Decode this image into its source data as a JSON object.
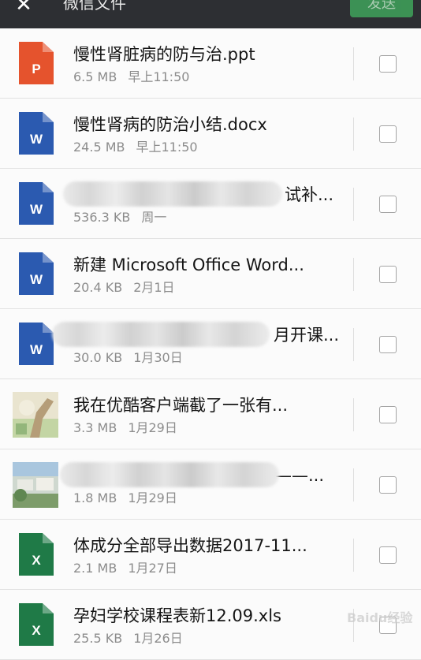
{
  "header": {
    "back_label": "✕",
    "title": "微信文件",
    "send_label": "发送"
  },
  "files": [
    {
      "name": "慢性肾脏病的防与治.ppt",
      "size": "6.5 MB",
      "date": "早上11:50",
      "type": "ppt",
      "icon_label": "P",
      "color": "#e5532d"
    },
    {
      "name": "慢性肾病的防治小结.docx",
      "size": "24.5 MB",
      "date": "早上11:50",
      "type": "word",
      "icon_label": "W",
      "color": "#2b5ab0"
    },
    {
      "name": "试补...",
      "size": "536.3 KB",
      "date": "周一",
      "type": "word",
      "icon_label": "W",
      "color": "#2b5ab0"
    },
    {
      "name": "新建 Microsoft Office Word...",
      "size": "20.4 KB",
      "date": "2月1日",
      "type": "word",
      "icon_label": "W",
      "color": "#2b5ab0"
    },
    {
      "name": "月开课...",
      "size": "30.0 KB",
      "date": "1月30日",
      "type": "word",
      "icon_label": "W",
      "color": "#2b5ab0"
    },
    {
      "name": "我在优酷客户端截了一张有...",
      "size": "3.3 MB",
      "date": "1月29日",
      "type": "image",
      "icon_label": "",
      "color": "#c9c2a0"
    },
    {
      "name": "——...",
      "size": "1.8 MB",
      "date": "1月29日",
      "type": "image",
      "icon_label": "",
      "color": "#9ab88e"
    },
    {
      "name": "体成分全部导出数据2017-11...",
      "size": "2.1 MB",
      "date": "1月27日",
      "type": "excel",
      "icon_label": "X",
      "color": "#1f7a47"
    },
    {
      "name": "孕妇学校课程表新12.09.xls",
      "size": "25.5 KB",
      "date": "1月26日",
      "type": "excel",
      "icon_label": "X",
      "color": "#1f7a47"
    }
  ],
  "watermark": "Baidu经验"
}
